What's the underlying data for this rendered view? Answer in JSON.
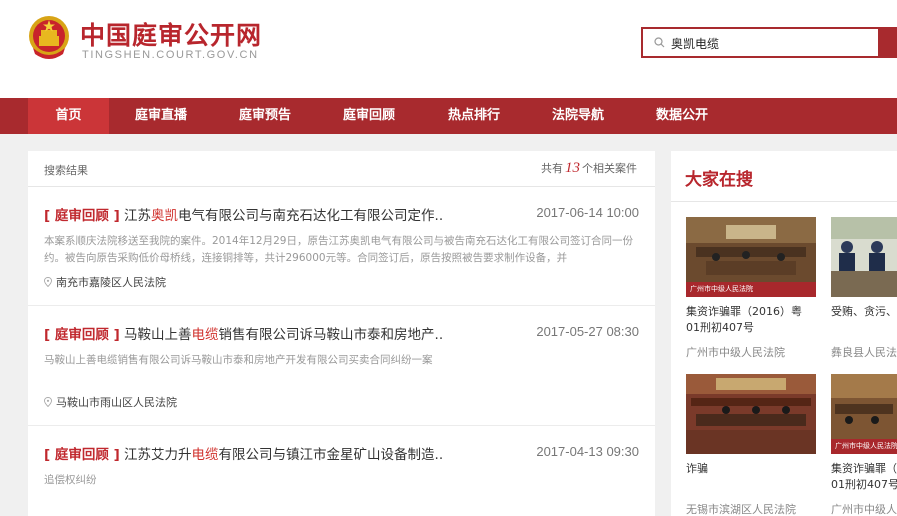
{
  "header": {
    "site_name": "中国庭审公开网",
    "site_domain": "TINGSHEN.COURT.GOV.CN",
    "search_value": "奥凯电缆"
  },
  "nav": [
    {
      "label": "首页",
      "active": true
    },
    {
      "label": "庭审直播"
    },
    {
      "label": "庭审预告"
    },
    {
      "label": "庭审回顾"
    },
    {
      "label": "热点排行"
    },
    {
      "label": "法院导航"
    },
    {
      "label": "数据公开"
    }
  ],
  "results": {
    "title": "搜索结果",
    "count_prefix": "共有",
    "count": "13",
    "count_suffix": "个相关案件",
    "items": [
      {
        "tag": "[ 庭审回顾 ]",
        "title_before": "江苏",
        "title_hl": "奥凯",
        "title_after": "电气有限公司与南充石达化工有限公司定作..",
        "date": "2017-06-14 10:00",
        "desc": "本案系顺庆法院移送至我院的案件。2014年12月29日，原告江苏奥凯电气有限公司与被告南充石达化工有限公司签订合同一份约。被告向原告采购低价母桥线，连接铜排等，共计296000元等。合同签订后，原告按照被告要求制作设备，并",
        "court": "南充市嘉陵区人民法院"
      },
      {
        "tag": "[ 庭审回顾 ]",
        "title_before": "马鞍山上善",
        "title_hl": "电缆",
        "title_after": "销售有限公司诉马鞍山市泰和房地产..",
        "date": "2017-05-27 08:30",
        "desc": "马鞍山上善电缆销售有限公司诉马鞍山市泰和房地产开发有限公司买卖合同纠纷一案",
        "court": "马鞍山市雨山区人民法院"
      },
      {
        "tag": "[ 庭审回顾 ]",
        "title_before": "江苏艾力升",
        "title_hl": "电缆",
        "title_after": "有限公司与镇江市金星矿山设备制造..",
        "date": "2017-04-13 09:30",
        "desc": "追偿权纠纷",
        "court": ""
      }
    ]
  },
  "sidebar": {
    "title": "大家在搜",
    "videos": [
      {
        "caption_line1": "集资诈骗罪（2016）粤",
        "caption_line2": "01刑初407号",
        "court": "广州市中级人民法院",
        "band": "广州市中级人民法院"
      },
      {
        "caption_line1": "受贿、贪污、",
        "caption_line2": "",
        "court": "彝良县人民法",
        "band": ""
      },
      {
        "caption_line1": "诈骗",
        "caption_line2": "",
        "court": "无锡市滨湖区人民法院",
        "band": ""
      },
      {
        "caption_line1": "集资诈骗罪（",
        "caption_line2": "01刑初407号",
        "court": "广州市中级人",
        "band": "广州市中级人民法院"
      }
    ]
  },
  "colors": {
    "brand_red": "#a82a2e",
    "nav_active": "#cb3538",
    "highlight": "#d0312d"
  }
}
